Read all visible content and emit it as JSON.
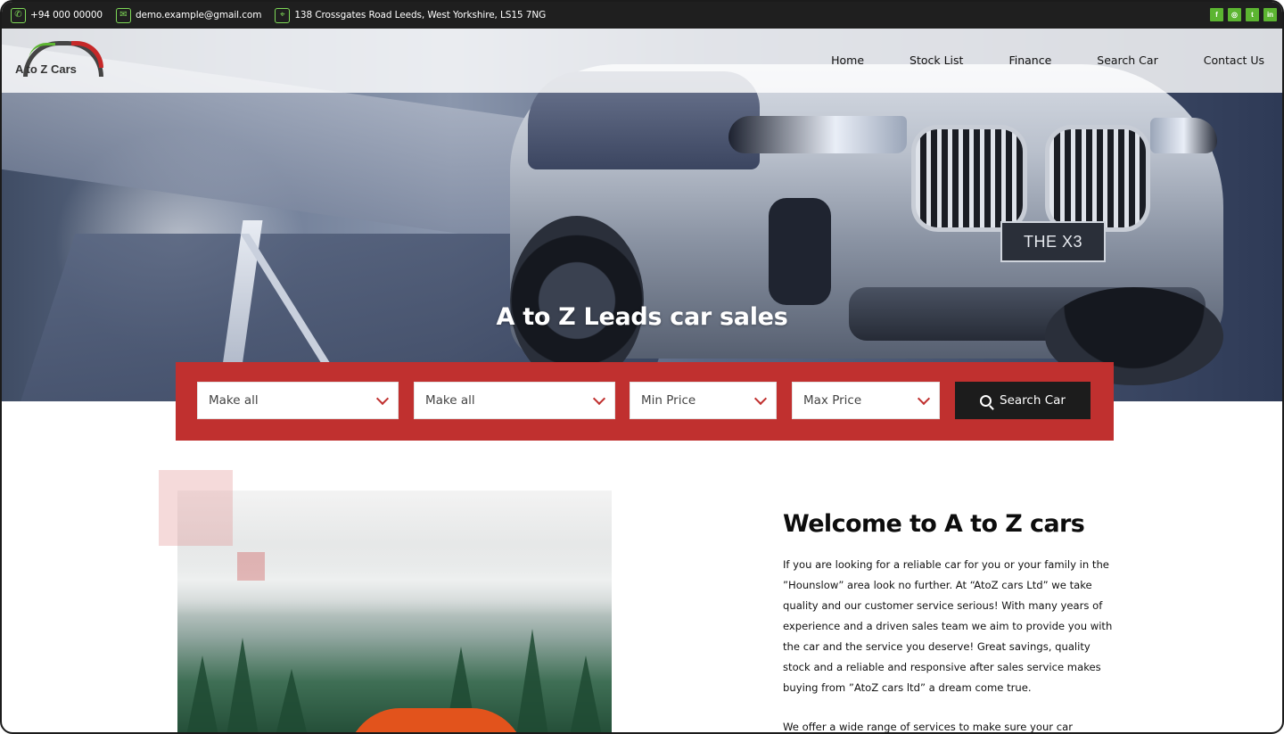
{
  "topbar": {
    "phone": "+94 000 00000",
    "email": "demo.example@gmail.com",
    "address": "138 Crossgates Road Leeds, West Yorkshire, LS15 7NG",
    "icons": [
      "phone-icon",
      "mail-icon",
      "location-icon"
    ],
    "socials": [
      {
        "name": "facebook-icon",
        "glyph": "f"
      },
      {
        "name": "instagram-icon",
        "glyph": "◎"
      },
      {
        "name": "twitter-icon",
        "glyph": "t"
      },
      {
        "name": "linkedin-icon",
        "glyph": "in"
      }
    ],
    "accent": "#7ed957"
  },
  "logo": {
    "text": "A to Z Cars"
  },
  "nav": {
    "home": "Home",
    "stock_list": "Stock List",
    "finance": "Finance",
    "search_car": "Search Car",
    "contact_us": "Contact Us"
  },
  "hero": {
    "title": "A to Z Leads car sales",
    "plate": "THE X3"
  },
  "search": {
    "make": "Make all",
    "model": "Make all",
    "min_price": "Min Price",
    "max_price": "Max Price",
    "button": "Search Car",
    "panel_color": "#c0302f"
  },
  "welcome": {
    "title": "Welcome to A to Z cars",
    "paragraph1": "If you are looking for a reliable car for you or your family in the ”Hounslow” area look no further. At “AtoZ cars Ltd” we take quality and our customer service serious! With many years of experience and a driven sales team we aim to provide you with the car and the service you deserve! Great savings, quality stock and a reliable and responsive after sales service makes buying from ”AtoZ cars ltd” a dream come true.",
    "paragraph2": "We offer a wide range of services to make sure your car"
  }
}
